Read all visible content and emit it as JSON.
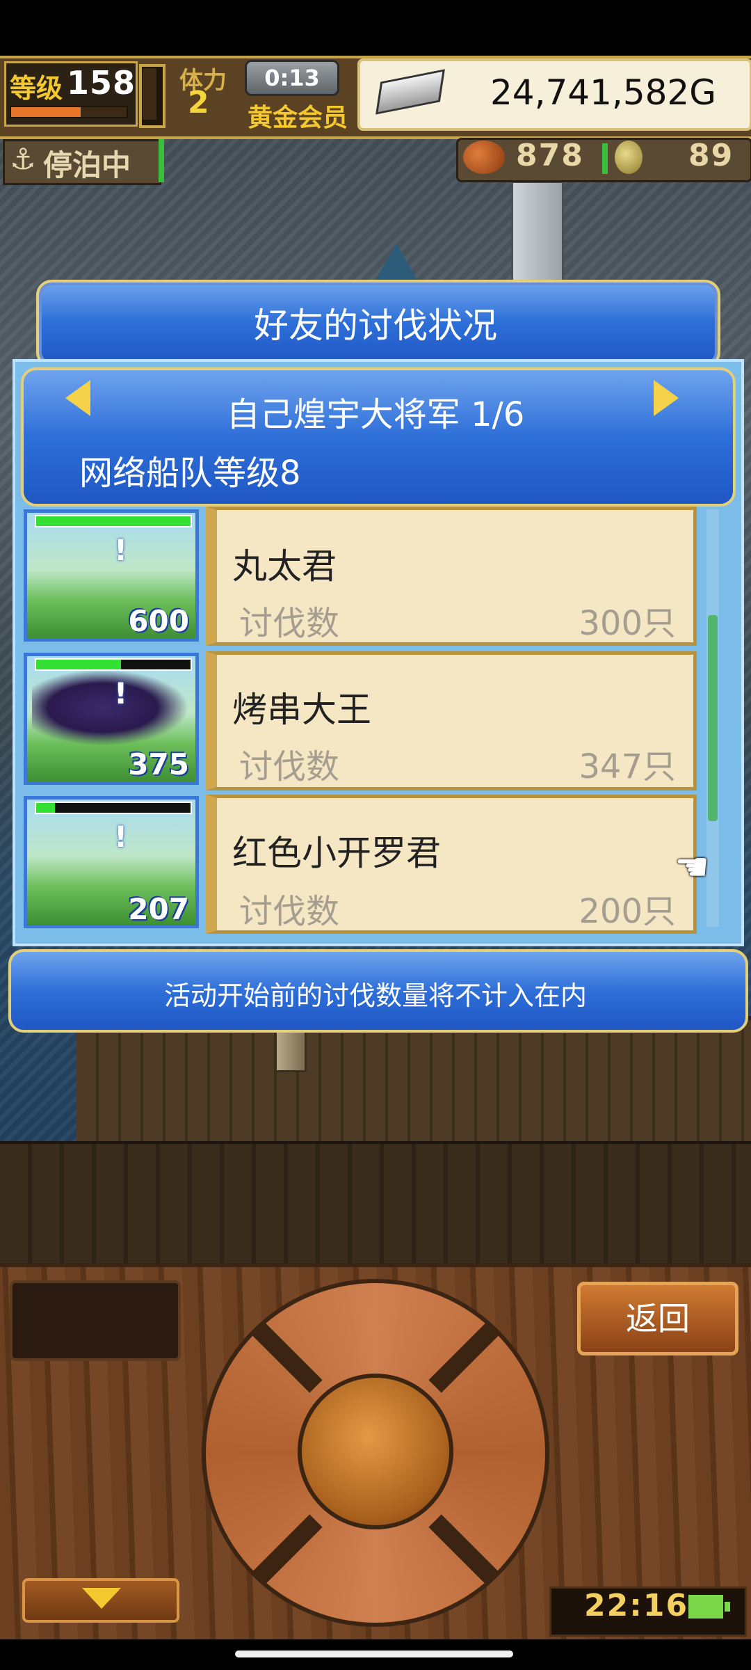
{
  "status": {
    "level_label": "等级",
    "level_value": "158",
    "level_exp_fraction": 0.6,
    "stamina_label": "体力",
    "stamina_value": "2",
    "timer": "0:13",
    "membership": "黄金会员",
    "gold": "24,741,582G"
  },
  "port": {
    "anchor_icon": "anchor-icon",
    "state_label": "停泊中"
  },
  "resources": {
    "resource1_icon": "fish-icon",
    "resource1": "878",
    "resource2_icon": "coin-icon",
    "resource2": "89"
  },
  "dialog": {
    "title": "好友的讨伐状况",
    "friend_name": "自己煌宇大将军 1/6",
    "fleet_level": "网络船队等级8",
    "notice": "活动开始前的讨伐数量将不计入在内",
    "rows": [
      {
        "name": "丸太君",
        "label": "讨伐数",
        "count": "300只",
        "thumb_mark": "!",
        "thumb_number": "600",
        "hp_fraction": 1.0
      },
      {
        "name": "烤串大王",
        "label": "讨伐数",
        "count": "347只",
        "thumb_mark": "!",
        "thumb_number": "375",
        "hp_fraction": 0.55
      },
      {
        "name": "红色小开罗君",
        "label": "讨伐数",
        "count": "200只",
        "thumb_mark": "!",
        "thumb_number": "207",
        "hp_fraction": 0.12
      }
    ],
    "scroll_fraction": 0.5
  },
  "controller": {
    "back_label": "返回",
    "clock": "22:16"
  },
  "colors": {
    "panel_blue": "#2e6fd8",
    "panel_gold_border": "#e3cf7a",
    "card_bg": "#f5e7c4",
    "hp_green": "#35e035",
    "accent_yellow": "#f4c930"
  }
}
